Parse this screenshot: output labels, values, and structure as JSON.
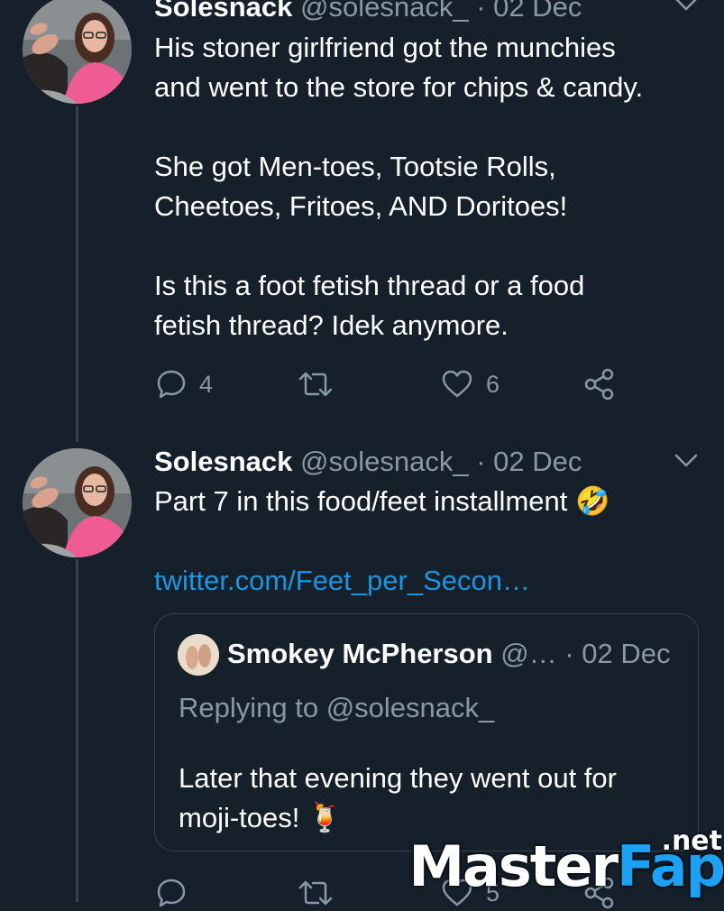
{
  "tweets": [
    {
      "name": "Solesnack",
      "handle": "@solesnack_",
      "separator": "·",
      "date": "02 Dec",
      "text": "His stoner girlfriend got the munchies\nand went to the store for chips & candy.\n\nShe got Men-toes, Tootsie Rolls,\nCheetoes, Fritoes, AND Doritoes!\n\nIs this a foot fetish thread or a food\nfetish thread? Idek anymore.",
      "reply_count": "4",
      "retweet_count": "",
      "like_count": "6",
      "icons": [
        "reply-icon",
        "retweet-icon",
        "like-icon",
        "share-icon"
      ]
    },
    {
      "name": "Solesnack",
      "handle": "@solesnack_",
      "separator": "·",
      "date": "02 Dec",
      "text": "Part 7 in this food/feet installment 🤣",
      "link": "twitter.com/Feet_per_Secon…",
      "quote": {
        "name": "Smokey McPherson",
        "handle": "@…",
        "separator": "·",
        "date": "02 Dec",
        "replying_to": "Replying to @solesnack_",
        "text": "Later that evening they went out for moji-toes! 🍹"
      },
      "reply_count": "",
      "retweet_count": "",
      "like_count": "5"
    }
  ],
  "watermark": {
    "part1": "Master",
    "part2": "Fap",
    "suffix": ".net"
  },
  "colors": {
    "background": "#15202b",
    "secondary_text": "#8899a6",
    "link": "#1b95e0",
    "border": "#38444d"
  }
}
